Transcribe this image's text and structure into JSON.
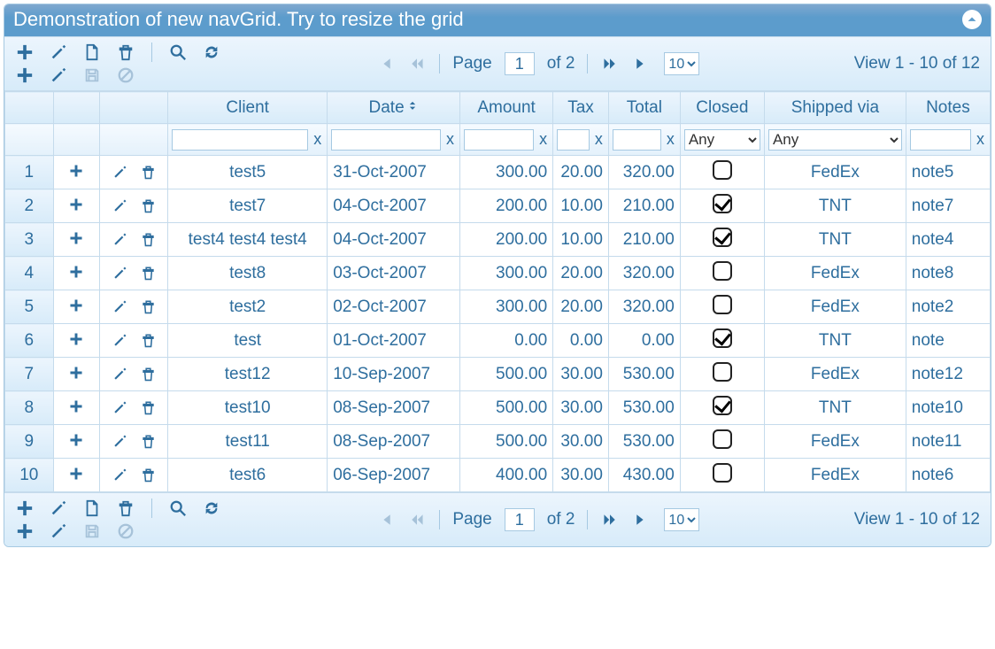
{
  "caption": "Demonstration of new navGrid. Try to resize the grid",
  "pager": {
    "page_label": "Page",
    "page_value": "1",
    "of_label": "of",
    "total_pages": "2",
    "rows_per_page": "10",
    "view_text": "View 1 - 10 of 12"
  },
  "columns": {
    "client": "Client",
    "date": "Date",
    "amount": "Amount",
    "tax": "Tax",
    "total": "Total",
    "closed": "Closed",
    "shipped": "Shipped via",
    "notes": "Notes"
  },
  "filters": {
    "closed_any": "Any",
    "ship_any": "Any",
    "clear": "x"
  },
  "rows": [
    {
      "n": "1",
      "client": "test5",
      "date": "31-Oct-2007",
      "amount": "300.00",
      "tax": "20.00",
      "total": "320.00",
      "closed": false,
      "ship": "FedEx",
      "notes": "note5"
    },
    {
      "n": "2",
      "client": "test7",
      "date": "04-Oct-2007",
      "amount": "200.00",
      "tax": "10.00",
      "total": "210.00",
      "closed": true,
      "ship": "TNT",
      "notes": "note7"
    },
    {
      "n": "3",
      "client": "test4 test4 test4",
      "date": "04-Oct-2007",
      "amount": "200.00",
      "tax": "10.00",
      "total": "210.00",
      "closed": true,
      "ship": "TNT",
      "notes": "note4"
    },
    {
      "n": "4",
      "client": "test8",
      "date": "03-Oct-2007",
      "amount": "300.00",
      "tax": "20.00",
      "total": "320.00",
      "closed": false,
      "ship": "FedEx",
      "notes": "note8"
    },
    {
      "n": "5",
      "client": "test2",
      "date": "02-Oct-2007",
      "amount": "300.00",
      "tax": "20.00",
      "total": "320.00",
      "closed": false,
      "ship": "FedEx",
      "notes": "note2"
    },
    {
      "n": "6",
      "client": "test",
      "date": "01-Oct-2007",
      "amount": "0.00",
      "tax": "0.00",
      "total": "0.00",
      "closed": true,
      "ship": "TNT",
      "notes": "note"
    },
    {
      "n": "7",
      "client": "test12",
      "date": "10-Sep-2007",
      "amount": "500.00",
      "tax": "30.00",
      "total": "530.00",
      "closed": false,
      "ship": "FedEx",
      "notes": "note12"
    },
    {
      "n": "8",
      "client": "test10",
      "date": "08-Sep-2007",
      "amount": "500.00",
      "tax": "30.00",
      "total": "530.00",
      "closed": true,
      "ship": "TNT",
      "notes": "note10"
    },
    {
      "n": "9",
      "client": "test11",
      "date": "08-Sep-2007",
      "amount": "500.00",
      "tax": "30.00",
      "total": "530.00",
      "closed": false,
      "ship": "FedEx",
      "notes": "note11"
    },
    {
      "n": "10",
      "client": "test6",
      "date": "06-Sep-2007",
      "amount": "400.00",
      "tax": "30.00",
      "total": "430.00",
      "closed": false,
      "ship": "FedEx",
      "notes": "note6"
    }
  ]
}
